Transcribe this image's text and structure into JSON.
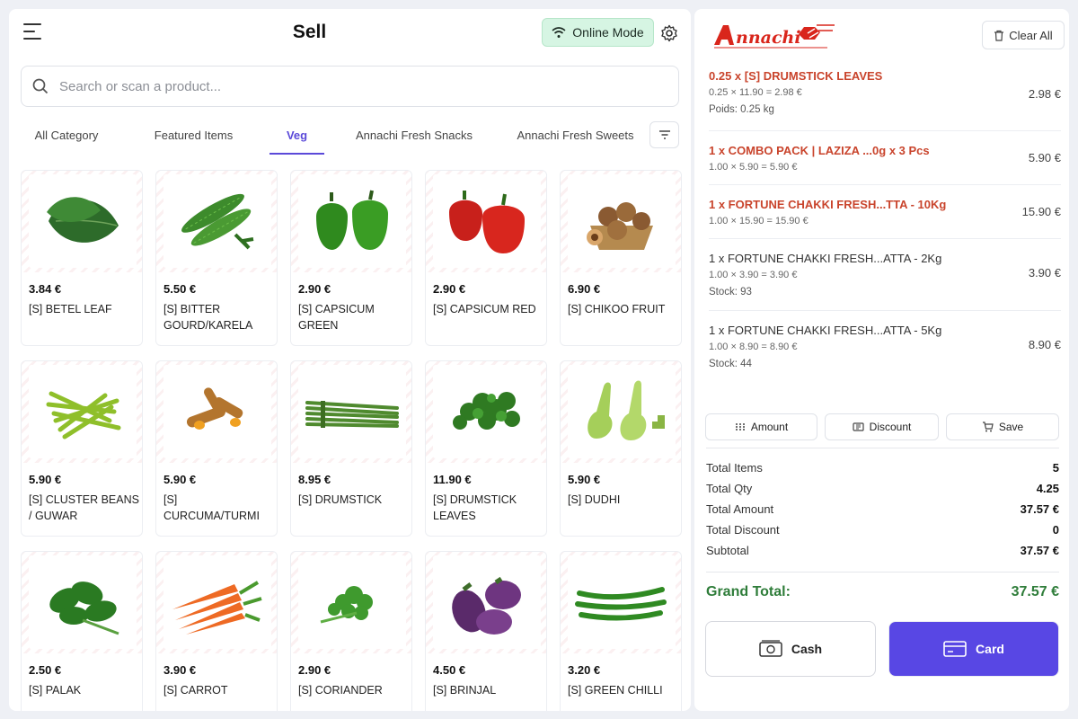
{
  "header": {
    "title": "Sell",
    "online_label": "Online Mode"
  },
  "search": {
    "placeholder": "Search or scan a product..."
  },
  "tabs": [
    "All Category",
    "Featured Items",
    "Veg",
    "Annachi Fresh Snacks",
    "Annachi Fresh Sweets"
  ],
  "active_tab": "Veg",
  "products": [
    {
      "price": "3.84 €",
      "name": "[S] BETEL LEAF",
      "icon": "betel-leaf"
    },
    {
      "price": "5.50 €",
      "name": "[S] BITTER GOURD/KARELA",
      "icon": "bitter-gourd"
    },
    {
      "price": "2.90 €",
      "name": "[S] CAPSICUM GREEN",
      "icon": "capsicum-green"
    },
    {
      "price": "2.90 €",
      "name": "[S] CAPSICUM RED",
      "icon": "capsicum-red"
    },
    {
      "price": "6.90 €",
      "name": "[S] CHIKOO FRUIT",
      "icon": "chikoo"
    },
    {
      "price": "5.90 €",
      "name": "[S] CLUSTER BEANS / GUWAR",
      "icon": "cluster-beans"
    },
    {
      "price": "5.90 €",
      "name": "[S] CURCUMA/TURMI",
      "icon": "turmeric"
    },
    {
      "price": "8.95 €",
      "name": "[S] DRUMSTICK",
      "icon": "drumstick"
    },
    {
      "price": "11.90 €",
      "name": "[S] DRUMSTICK LEAVES",
      "icon": "drumstick-leaves"
    },
    {
      "price": "5.90 €",
      "name": "[S] DUDHI",
      "icon": "dudhi"
    },
    {
      "price": "2.50 €",
      "name": "[S] PALAK",
      "icon": "palak"
    },
    {
      "price": "3.90 €",
      "name": "[S] CARROT",
      "icon": "carrot"
    },
    {
      "price": "2.90 €",
      "name": "[S] CORIANDER",
      "icon": "coriander"
    },
    {
      "price": "4.50 €",
      "name": "[S] BRINJAL",
      "icon": "brinjal"
    },
    {
      "price": "3.20 €",
      "name": "[S] GREEN CHILLI",
      "icon": "green-chilli"
    }
  ],
  "right": {
    "clear_label": "Clear All",
    "cart": [
      {
        "title": "0.25 x [S] DRUMSTICK LEAVES",
        "calc": "0.25 × 11.90 = 2.98 €",
        "extra": "Poids: 0.25 kg",
        "amount": "2.98 €",
        "highlight": true
      },
      {
        "title": "1 x COMBO PACK | LAZIZA ...0g x 3 Pcs",
        "calc": "1.00 × 5.90 = 5.90 €",
        "extra": "",
        "amount": "5.90 €",
        "highlight": true
      },
      {
        "title": "1 x FORTUNE CHAKKI FRESH...TTA - 10Kg",
        "calc": "1.00 × 15.90 = 15.90 €",
        "extra": "",
        "amount": "15.90 €",
        "highlight": true
      },
      {
        "title": "1 x FORTUNE CHAKKI FRESH...ATTA - 2Kg",
        "calc": "1.00 × 3.90 = 3.90 €",
        "extra": "Stock: 93",
        "amount": "3.90 €",
        "highlight": false
      },
      {
        "title": "1 x FORTUNE CHAKKI FRESH...ATTA - 5Kg",
        "calc": "1.00 × 8.90 = 8.90 €",
        "extra": "Stock: 44",
        "amount": "8.90 €",
        "highlight": false
      }
    ],
    "actions": {
      "amount": "Amount",
      "discount": "Discount",
      "save": "Save"
    },
    "totals": {
      "items_label": "Total Items",
      "items": "5",
      "qty_label": "Total Qty",
      "qty": "4.25",
      "amount_label": "Total Amount",
      "amount": "37.57 €",
      "discount_label": "Total Discount",
      "discount": "0",
      "subtotal_label": "Subtotal",
      "subtotal": "37.57 €"
    },
    "grand_label": "Grand Total:",
    "grand_value": "37.57 €",
    "pay": {
      "cash": "Cash",
      "card": "Card"
    }
  },
  "colors": {
    "accent": "#5847e4",
    "grand_total": "#2f7d3a",
    "cart_highlight": "#c9442c",
    "online_bg": "#d6f5e3"
  }
}
